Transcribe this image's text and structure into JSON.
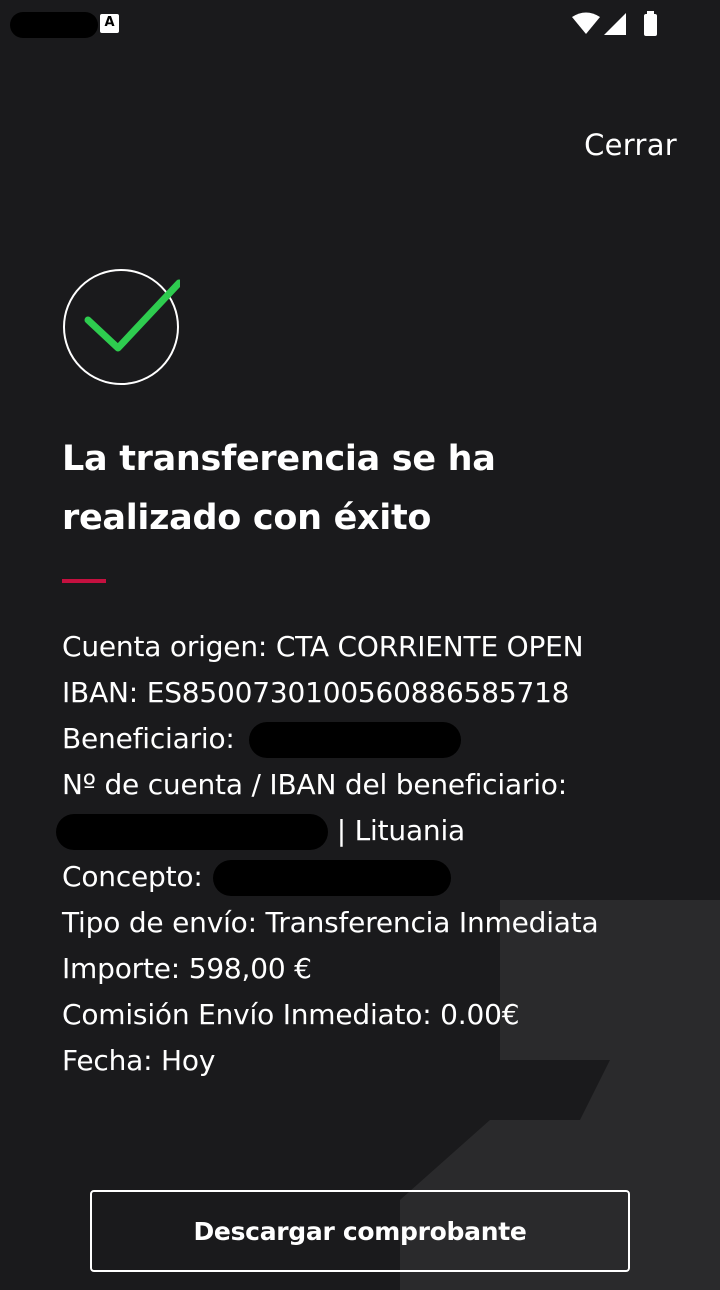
{
  "status_bar": {
    "notification_letter": "A"
  },
  "header": {
    "close_label": "Cerrar"
  },
  "main": {
    "title": "La transferencia se ha realizado con éxito",
    "details": [
      {
        "label": "Cuenta origen:",
        "value": "CTA CORRIENTE OPEN"
      },
      {
        "label": "IBAN:",
        "value": "ES8500730100560886585718"
      },
      {
        "label": "Beneficiario:",
        "value": ""
      },
      {
        "label": "Nº de cuenta / IBAN del beneficiario:",
        "value": ""
      },
      {
        "label": "",
        "value": "| Lituania"
      },
      {
        "label": "Concepto:",
        "value": ""
      },
      {
        "label": "Tipo de envío:",
        "value": "Transferencia Inmediata"
      },
      {
        "label": "Importe:",
        "value": "598,00 €"
      },
      {
        "label": "Comisión Envío Inmediato:",
        "value": "0.00€"
      },
      {
        "label": "Fecha:",
        "value": "Hoy"
      }
    ]
  },
  "footer": {
    "download_label": "Descargar comprobante"
  },
  "colors": {
    "background": "#1a1a1c",
    "accent": "#c4103f",
    "success": "#2ecc4f"
  },
  "icons": {
    "success": "checkmark-circle-icon",
    "wifi": "wifi-icon",
    "signal": "signal-icon",
    "battery": "battery-icon"
  }
}
